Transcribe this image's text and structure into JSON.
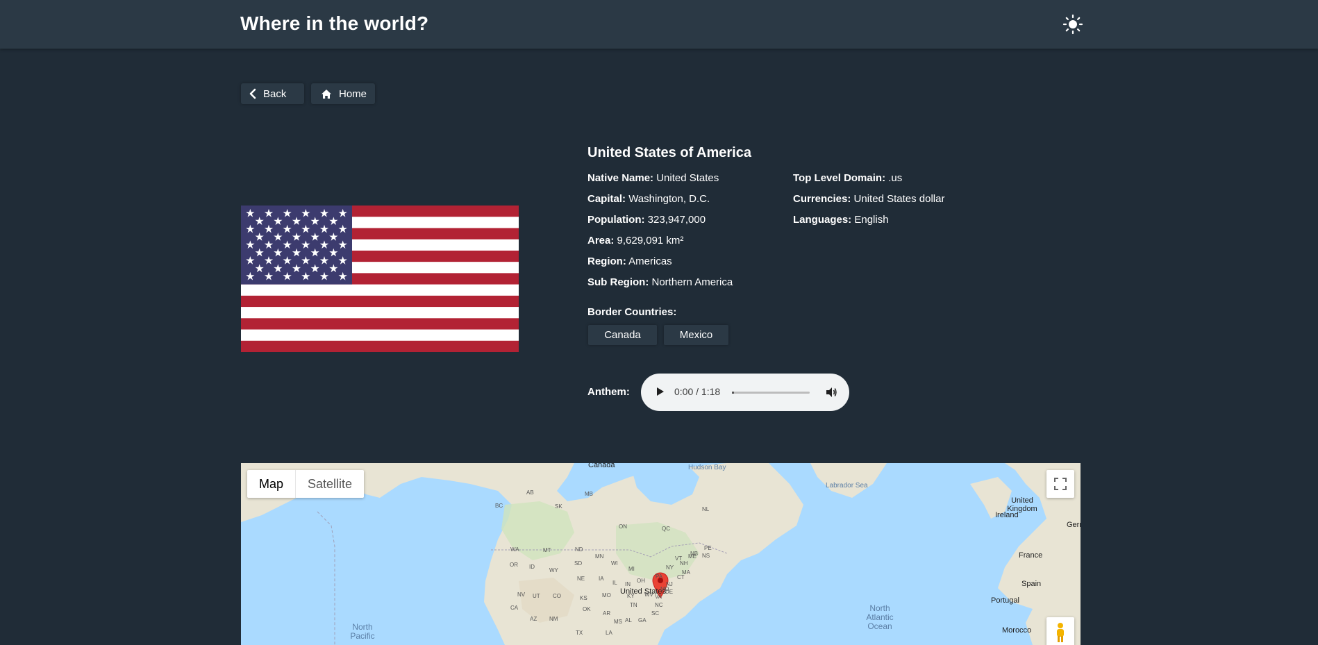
{
  "header": {
    "title": "Where in the world?",
    "theme_icon": "sun-icon"
  },
  "nav": {
    "back_label": "Back",
    "home_label": "Home"
  },
  "country": {
    "name": "United States of America",
    "flag_icon": "us-flag",
    "details_left": [
      {
        "label": "Native Name:",
        "value": "United States"
      },
      {
        "label": "Capital:",
        "value": "Washington, D.C."
      },
      {
        "label": "Population:",
        "value": "323,947,000"
      },
      {
        "label": "Area:",
        "value": "9,629,091 km²"
      },
      {
        "label": "Region:",
        "value": "Americas"
      },
      {
        "label": "Sub Region:",
        "value": "Northern America"
      }
    ],
    "details_right": [
      {
        "label": "Top Level Domain:",
        "value": ".us"
      },
      {
        "label": "Currencies:",
        "value": "United States dollar"
      },
      {
        "label": "Languages:",
        "value": "English"
      }
    ],
    "border_label": "Border Countries:",
    "borders": [
      "Canada",
      "Mexico"
    ],
    "anthem_label": "Anthem:"
  },
  "audio": {
    "time": "0:00 / 1:18",
    "progress": 0
  },
  "map": {
    "type_map": "Map",
    "type_satellite": "Satellite",
    "labels": {
      "canada": "Canada",
      "hudson_bay": "Hudson Bay",
      "labrador_sea": "Labrador Sea",
      "ireland": "Ireland",
      "united_kingdom": "United Kingdom",
      "france": "France",
      "spain": "Spain",
      "portugal": "Portugal",
      "morocco": "Morocco",
      "germany": "Germ",
      "united_states": "United States",
      "north_atlantic": "North Atlantic Ocean",
      "north_pacific": "North Pacific"
    },
    "states": [
      "AB",
      "MB",
      "SK",
      "BC",
      "ON",
      "QC",
      "NL",
      "NB",
      "NS",
      "PE",
      "WA",
      "MT",
      "ND",
      "MN",
      "OR",
      "ID",
      "WY",
      "SD",
      "WI",
      "MI",
      "NE",
      "IA",
      "IL",
      "IN",
      "OH",
      "PA",
      "NY",
      "VT",
      "NH",
      "ME",
      "MA",
      "CT",
      "NJ",
      "MD",
      "DE",
      "WV",
      "VA",
      "KY",
      "NV",
      "UT",
      "CO",
      "KS",
      "MO",
      "TN",
      "NC",
      "SC",
      "CA",
      "AZ",
      "NM",
      "OK",
      "AR",
      "MS",
      "AL",
      "GA",
      "TX",
      "LA"
    ]
  },
  "colors": {
    "background": "#202c37",
    "element": "#2b3945",
    "map_water": "#aadaff",
    "map_land": "#e8e4d4",
    "marker": "#ea4335",
    "flag_red": "#b22234",
    "flag_blue": "#3c3b6e"
  }
}
